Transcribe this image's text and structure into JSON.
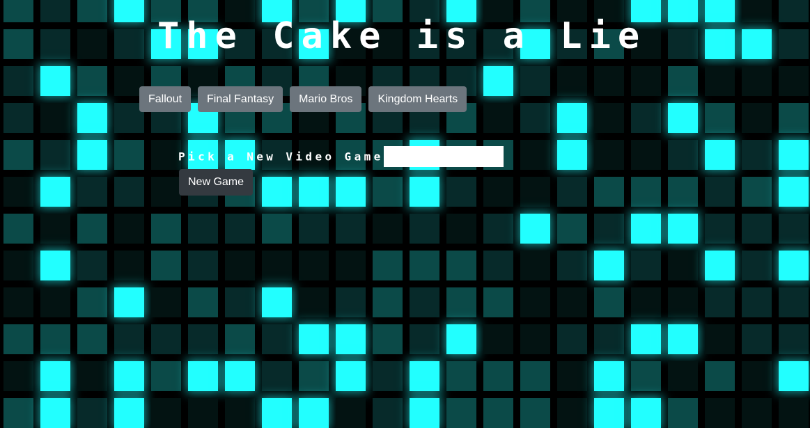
{
  "header": {
    "title": "The Cake is a Lie"
  },
  "games": [
    {
      "label": "Fallout"
    },
    {
      "label": "Final Fantasy"
    },
    {
      "label": "Mario Bros"
    },
    {
      "label": "Kingdom Hearts"
    }
  ],
  "form": {
    "label": "Pick a New Video Game",
    "input_value": "",
    "submit_label": "New Game"
  },
  "colors": {
    "accent": "#22ffff",
    "button": "#6c757d",
    "button_dark": "#343a40"
  }
}
